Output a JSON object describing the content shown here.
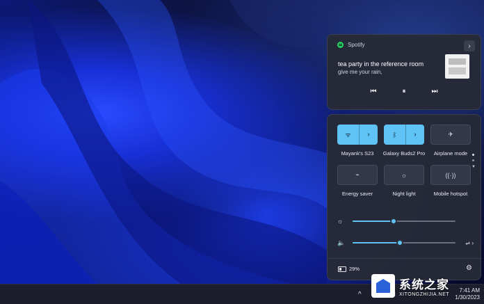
{
  "media": {
    "app_name": "Spotify",
    "expand_glyph": "›",
    "track_title": "tea party in the reference room",
    "track_artist": "give me your rain,",
    "prev_glyph": "⏮",
    "pause_glyph": "⏸",
    "next_glyph": "⏭"
  },
  "quick_settings": {
    "tiles": [
      {
        "label": "Mayank's S23",
        "icon": "wifi-icon",
        "glyph": "ᯤ",
        "state": "on",
        "split": true
      },
      {
        "label": "Galaxy Buds2 Pro",
        "icon": "bluetooth-icon",
        "glyph": "ᛒ",
        "state": "on",
        "split": true
      },
      {
        "label": "Airplane mode",
        "icon": "airplane-icon",
        "glyph": "✈",
        "state": "off",
        "split": false
      },
      {
        "label": "Energy saver",
        "icon": "energy-saver-icon",
        "glyph": "⌁",
        "state": "off",
        "split": false
      },
      {
        "label": "Night light",
        "icon": "night-light-icon",
        "glyph": "☼",
        "state": "off",
        "split": false
      },
      {
        "label": "Mobile hotspot",
        "icon": "hotspot-icon",
        "glyph": "((·))",
        "state": "off",
        "split": false
      }
    ],
    "split_glyph": "›",
    "brightness": {
      "icon_glyph": "☼",
      "level": 0.4
    },
    "volume": {
      "icon_glyph": "🔈",
      "level": 0.46,
      "extra_glyph": "⇌ ›"
    },
    "battery_text": "29%",
    "settings_glyph": "⚙"
  },
  "pager": {
    "page": 1,
    "total": 2
  },
  "taskbar": {
    "chevron_glyph": "^",
    "time_text": "7:41 AM",
    "date_text": "1/30/2023"
  },
  "watermark": {
    "cn_text": "系统之家",
    "url_text": "XITONGZHIJIA.NET"
  },
  "colors": {
    "accent": "#5fc3f5",
    "spotify": "#1ed760",
    "panel": "#262a36"
  }
}
